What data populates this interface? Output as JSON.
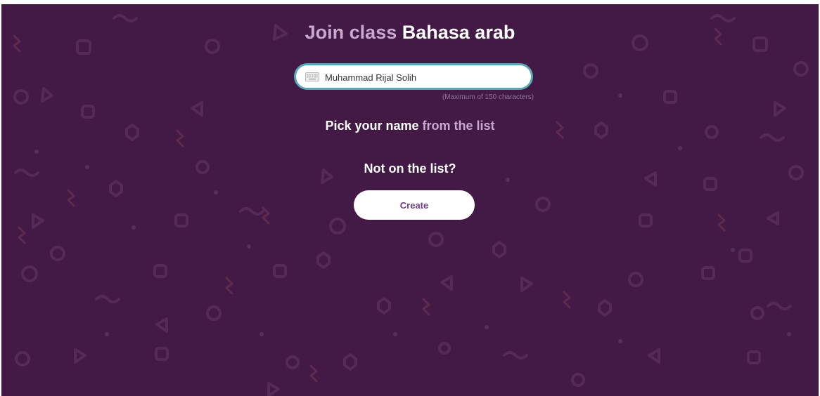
{
  "header": {
    "title_prefix": "Join class",
    "class_name": "Bahasa arab"
  },
  "name_field": {
    "value": "Muhammad Rijal Solih",
    "icon": "keyboard-icon",
    "helper_text": "(Maximum of 150 characters)"
  },
  "pick_prompt": {
    "strong": "Pick your name",
    "muted": "from the list"
  },
  "not_on_list": {
    "label": "Not on the list?",
    "button_label": "Create"
  },
  "colors": {
    "background": "#421a45",
    "title_muted": "#c9a9cc",
    "input_border": "#5aa6b8",
    "button_text": "#6f3b87"
  }
}
